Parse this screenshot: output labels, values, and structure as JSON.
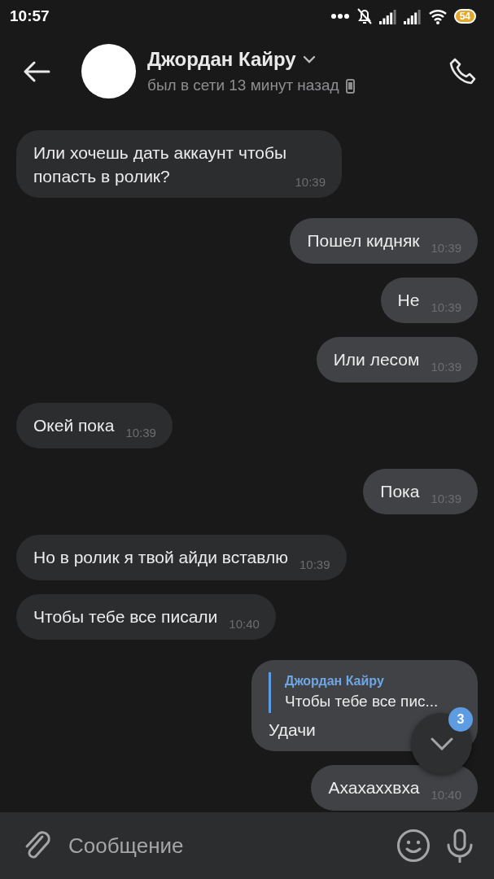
{
  "status_bar": {
    "time": "10:57",
    "battery": "54"
  },
  "header": {
    "name": "Джордан Кайру",
    "status": "был в сети 13 минут назад"
  },
  "messages": [
    {
      "outgoing": false,
      "text": "Или хочешь дать аккаунт чтобы попасть в ролик?",
      "time": "10:39"
    },
    {
      "outgoing": true,
      "text": "Пошел кидняк",
      "time": "10:39"
    },
    {
      "outgoing": true,
      "text": "Не",
      "time": "10:39"
    },
    {
      "outgoing": true,
      "text": "Или лесом",
      "time": "10:39"
    },
    {
      "outgoing": false,
      "text": "Окей пока",
      "time": "10:39"
    },
    {
      "outgoing": true,
      "text": "Пока",
      "time": "10:39"
    },
    {
      "outgoing": false,
      "text": "Но в ролик я твой айди вставлю",
      "time": "10:39"
    },
    {
      "outgoing": false,
      "text": "Чтобы тебе все писали",
      "time": "10:40"
    },
    {
      "outgoing": true,
      "text": "Удачи",
      "reply": {
        "author": "Джордан Кайру",
        "text": "Чтобы тебе все пис..."
      }
    },
    {
      "outgoing": true,
      "text": "Ахахаххвха",
      "time": "10:40"
    }
  ],
  "scroll_button": {
    "badge": "3"
  },
  "composer": {
    "placeholder": "Сообщение"
  }
}
